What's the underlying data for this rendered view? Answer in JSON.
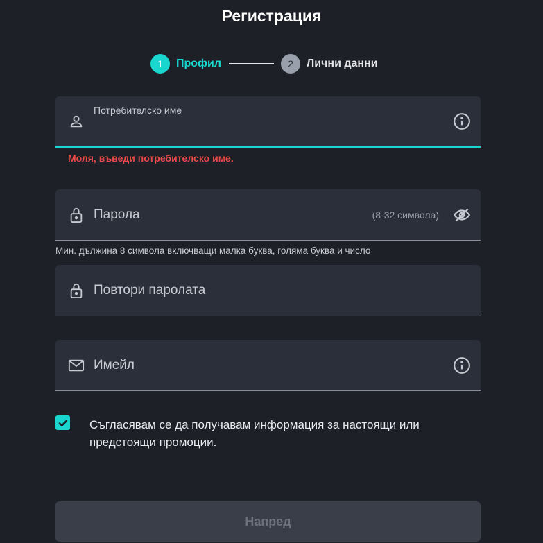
{
  "page": {
    "title": "Регистрация"
  },
  "stepper": {
    "steps": [
      {
        "number": "1",
        "label": "Профил",
        "state": "active"
      },
      {
        "number": "2",
        "label": "Лични данни",
        "state": "inactive"
      }
    ]
  },
  "form": {
    "username": {
      "label": "Потребителско име",
      "value": "",
      "error": "Моля, въведи потребителско име.",
      "lead_icon": "user-icon",
      "trail_icon": "info-icon"
    },
    "password": {
      "label": "Парола",
      "value": "",
      "hint_inline": "(8-32 символа)",
      "helper": "Мин. дължина 8 символа включващи малка буква, голяма буква и число",
      "lead_icon": "lock-icon",
      "trail_icon": "eye-off-icon"
    },
    "repeat_password": {
      "label": "Повтори паролата",
      "value": "",
      "lead_icon": "lock-icon"
    },
    "email": {
      "label": "Имейл",
      "value": "",
      "lead_icon": "mail-icon",
      "trail_icon": "info-icon"
    },
    "consent": {
      "checked": true,
      "text": "Съгласявам се да получавам информация за настоящи или предстоящи промоции."
    },
    "next_button": {
      "label": "Напред",
      "enabled": false
    }
  },
  "colors": {
    "background": "#1d2027",
    "field_bg": "#2b2f39",
    "accent": "#19d6cf",
    "error": "#e84a4a",
    "button_disabled_bg": "#3a3e48",
    "button_disabled_text": "#6c717c"
  }
}
